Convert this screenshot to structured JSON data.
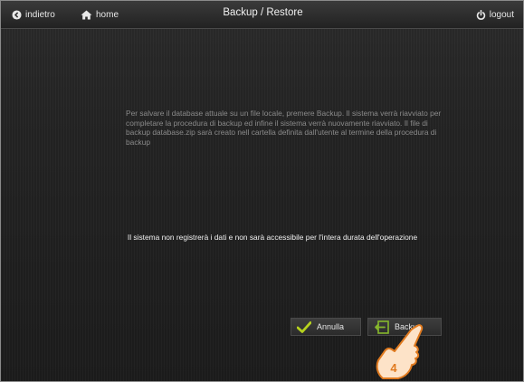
{
  "header": {
    "back_label": "indietro",
    "home_label": "home",
    "title": "Backup / Restore",
    "logout_label": "logout"
  },
  "main": {
    "info_text": "Per salvare il database attuale su un file locale, premere Backup. Il sistema verrà riavviato per completare la procedura di backup ed infine il sistema verrà nuovamente riavviato. Il file di backup database.zip sarà creato nell cartella definita dall'utente al termine della procedura di backup",
    "warning_text": "Il sistema non registrerà i dati e non sarà accessibile per l'intera durata dell'operazione"
  },
  "buttons": {
    "cancel_label": "Annulla",
    "backup_label": "Backup"
  },
  "callout": {
    "step_number": "4"
  },
  "icons": {
    "back": "back-circle-icon",
    "home": "home-icon",
    "logout": "power-icon",
    "cancel": "checkmark-icon",
    "backup": "backup-arrow-icon",
    "pointer": "hand-pointer-icon"
  },
  "colors": {
    "background": "#232323",
    "topbar": "#2e2e2e",
    "checkmark": "#b6d21e",
    "backup_icon": "#86b72c",
    "hand_fill": "#fde3c8",
    "hand_outline": "#e07a1f",
    "step_number": "#e07a1f"
  }
}
